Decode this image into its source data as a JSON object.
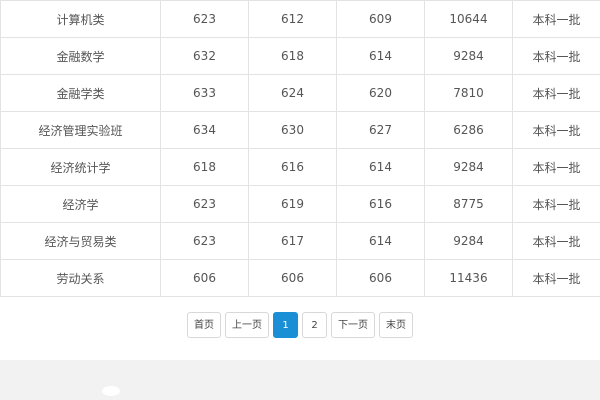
{
  "table": {
    "rows": [
      {
        "major": "计算机类",
        "c1": "623",
        "c2": "612",
        "c3": "609",
        "c4": "10644",
        "batch": "本科一批"
      },
      {
        "major": "金融数学",
        "c1": "632",
        "c2": "618",
        "c3": "614",
        "c4": "9284",
        "batch": "本科一批"
      },
      {
        "major": "金融学类",
        "c1": "633",
        "c2": "624",
        "c3": "620",
        "c4": "7810",
        "batch": "本科一批"
      },
      {
        "major": "经济管理实验班",
        "c1": "634",
        "c2": "630",
        "c3": "627",
        "c4": "6286",
        "batch": "本科一批"
      },
      {
        "major": "经济统计学",
        "c1": "618",
        "c2": "616",
        "c3": "614",
        "c4": "9284",
        "batch": "本科一批"
      },
      {
        "major": "经济学",
        "c1": "623",
        "c2": "619",
        "c3": "616",
        "c4": "8775",
        "batch": "本科一批"
      },
      {
        "major": "经济与贸易类",
        "c1": "623",
        "c2": "617",
        "c3": "614",
        "c4": "9284",
        "batch": "本科一批"
      },
      {
        "major": "劳动关系",
        "c1": "606",
        "c2": "606",
        "c3": "606",
        "c4": "11436",
        "batch": "本科一批"
      }
    ]
  },
  "pagination": {
    "first": "首页",
    "prev": "上一页",
    "page1": "1",
    "page2": "2",
    "next": "下一页",
    "last": "末页",
    "active_color": "#1a8fd6"
  }
}
